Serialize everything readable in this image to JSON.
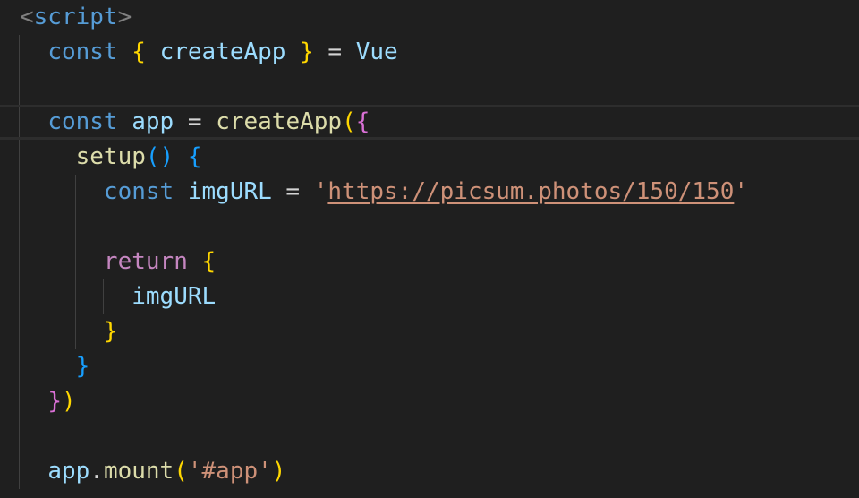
{
  "editor": {
    "language": "html",
    "theme": "Dark Modern",
    "colors": {
      "background": "#1f1f1f",
      "keyword": "#569cd6",
      "control_keyword": "#c586c0",
      "variable": "#9cdcfe",
      "function": "#dcdcaa",
      "string": "#ce9178",
      "bracket_level_1": "#ffd700",
      "bracket_level_2": "#da70d6",
      "bracket_level_3": "#179fff"
    },
    "lines": [
      [
        {
          "t": "<",
          "c": "tag-punct"
        },
        {
          "t": "script",
          "c": "tag-name"
        },
        {
          "t": ">",
          "c": "tag-punct"
        }
      ],
      [
        {
          "t": "  ",
          "c": "plain"
        },
        {
          "t": "const",
          "c": "keyword"
        },
        {
          "t": " ",
          "c": "plain"
        },
        {
          "t": "{",
          "c": "brace-y"
        },
        {
          "t": " ",
          "c": "plain"
        },
        {
          "t": "createApp",
          "c": "variable"
        },
        {
          "t": " ",
          "c": "plain"
        },
        {
          "t": "}",
          "c": "brace-y"
        },
        {
          "t": " = ",
          "c": "plain"
        },
        {
          "t": "Vue",
          "c": "variable"
        }
      ],
      [],
      [
        {
          "t": "  ",
          "c": "plain"
        },
        {
          "t": "const",
          "c": "keyword"
        },
        {
          "t": " ",
          "c": "plain"
        },
        {
          "t": "app",
          "c": "variable"
        },
        {
          "t": " = ",
          "c": "plain"
        },
        {
          "t": "createApp",
          "c": "func"
        },
        {
          "t": "(",
          "c": "brace-y"
        },
        {
          "t": "{",
          "c": "brace-p"
        }
      ],
      [
        {
          "t": "    ",
          "c": "plain"
        },
        {
          "t": "setup",
          "c": "func"
        },
        {
          "t": "()",
          "c": "brace-b"
        },
        {
          "t": " ",
          "c": "plain"
        },
        {
          "t": "{",
          "c": "brace-b"
        }
      ],
      [
        {
          "t": "      ",
          "c": "plain"
        },
        {
          "t": "const",
          "c": "keyword"
        },
        {
          "t": " ",
          "c": "plain"
        },
        {
          "t": "imgURL",
          "c": "variable"
        },
        {
          "t": " = ",
          "c": "plain"
        },
        {
          "t": "'",
          "c": "string"
        },
        {
          "t": "https://picsum.photos/150/150",
          "c": "string-link"
        },
        {
          "t": "'",
          "c": "string"
        }
      ],
      [],
      [
        {
          "t": "      ",
          "c": "plain"
        },
        {
          "t": "return",
          "c": "keyword-flow"
        },
        {
          "t": " ",
          "c": "plain"
        },
        {
          "t": "{",
          "c": "brace-y"
        }
      ],
      [
        {
          "t": "        ",
          "c": "plain"
        },
        {
          "t": "imgURL",
          "c": "variable"
        }
      ],
      [
        {
          "t": "      ",
          "c": "plain"
        },
        {
          "t": "}",
          "c": "brace-y"
        }
      ],
      [
        {
          "t": "    ",
          "c": "plain"
        },
        {
          "t": "}",
          "c": "brace-b"
        }
      ],
      [
        {
          "t": "  ",
          "c": "plain"
        },
        {
          "t": "}",
          "c": "brace-p"
        },
        {
          "t": ")",
          "c": "brace-y"
        }
      ],
      [],
      [
        {
          "t": "  ",
          "c": "plain"
        },
        {
          "t": "app",
          "c": "variable"
        },
        {
          "t": ".",
          "c": "plain"
        },
        {
          "t": "mount",
          "c": "func"
        },
        {
          "t": "(",
          "c": "brace-y"
        },
        {
          "t": "'#app'",
          "c": "string"
        },
        {
          "t": ")",
          "c": "brace-y"
        }
      ]
    ]
  }
}
